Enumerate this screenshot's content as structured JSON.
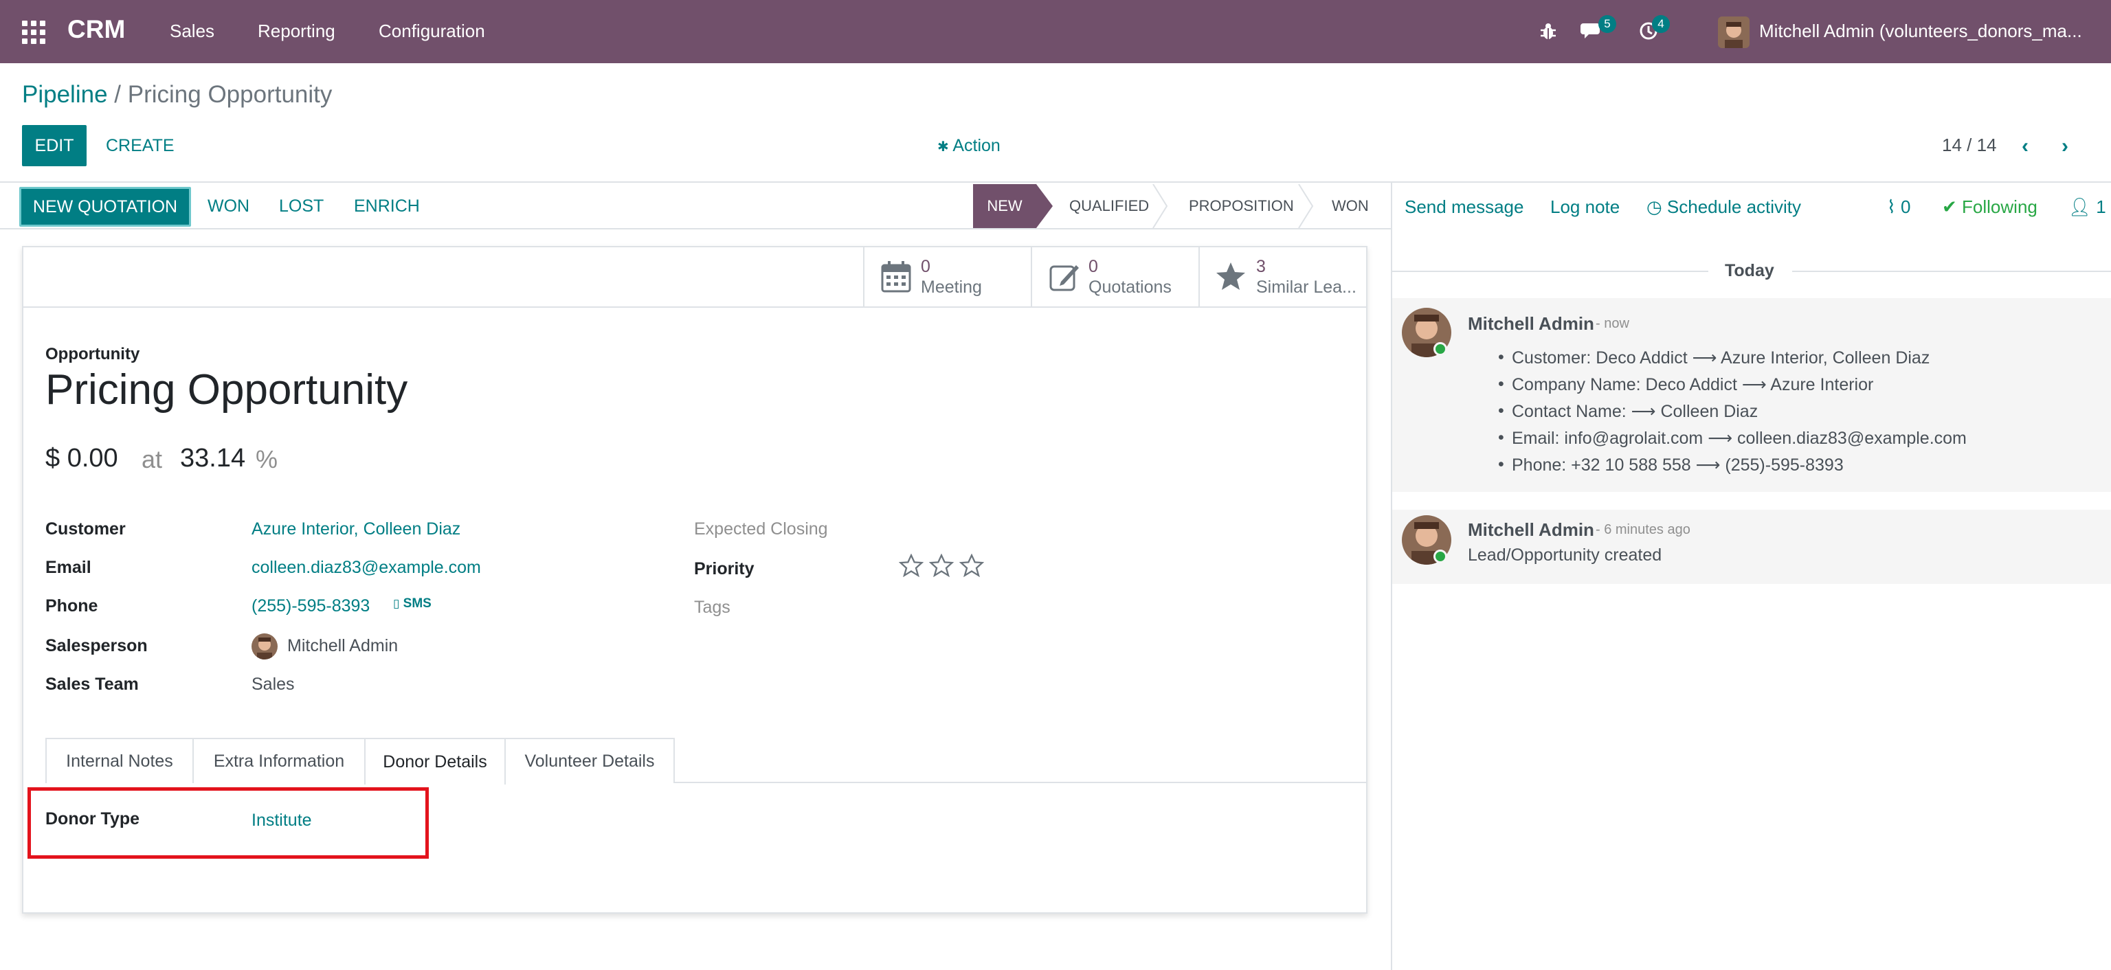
{
  "navbar": {
    "app_name": "CRM",
    "menus": [
      "Sales",
      "Reporting",
      "Configuration"
    ],
    "messages_badge": "5",
    "activities_badge": "4",
    "user": "Mitchell Admin (volunteers_donors_ma..."
  },
  "breadcrumb": {
    "parent": "Pipeline",
    "separator": "/",
    "current": "Pricing Opportunity"
  },
  "control": {
    "edit_label": "EDIT",
    "create_label": "CREATE",
    "action_label": "Action",
    "pager": "14 / 14"
  },
  "statusbar": {
    "new_quotation": "NEW QUOTATION",
    "won": "WON",
    "lost": "LOST",
    "enrich": "ENRICH",
    "stages": [
      "NEW",
      "QUALIFIED",
      "PROPOSITION",
      "WON"
    ],
    "active_stage": "NEW"
  },
  "smart_buttons": [
    {
      "value": "0",
      "label": "Meeting",
      "icon": "calendar-icon"
    },
    {
      "value": "0",
      "label": "Quotations",
      "icon": "pencil-square-icon"
    },
    {
      "value": "3",
      "label": "Similar Lea...",
      "icon": "star-icon"
    }
  ],
  "record": {
    "type_label": "Opportunity",
    "title": "Pricing Opportunity",
    "revenue": "$ 0.00",
    "at_label": "at",
    "probability": "33.14",
    "percent_sign": "%"
  },
  "fields": {
    "customer_label": "Customer",
    "customer": "Azure Interior, Colleen Diaz",
    "email_label": "Email",
    "email": "colleen.diaz83@example.com",
    "phone_label": "Phone",
    "phone": "(255)-595-8393",
    "sms": "SMS",
    "salesperson_label": "Salesperson",
    "salesperson": "Mitchell Admin",
    "sales_team_label": "Sales Team",
    "sales_team": "Sales",
    "expected_closing_label": "Expected Closing",
    "priority_label": "Priority",
    "priority_stars": 0,
    "priority_max": 3,
    "tags_label": "Tags"
  },
  "tabs": [
    "Internal Notes",
    "Extra Information",
    "Donor Details",
    "Volunteer Details"
  ],
  "active_tab": "Donor Details",
  "donor": {
    "type_label": "Donor Type",
    "type_value": "Institute"
  },
  "chatter": {
    "send_message": "Send message",
    "log_note": "Log note",
    "schedule_activity": "Schedule activity",
    "attachments": "0",
    "following": "Following",
    "followers": "1",
    "today": "Today",
    "messages": [
      {
        "author": "Mitchell Admin",
        "when": "- now",
        "changes": [
          "Customer: Deco Addict ⟶ Azure Interior, Colleen Diaz",
          "Company Name: Deco Addict ⟶ Azure Interior",
          "Contact Name: ⟶ Colleen Diaz",
          "Email: info@agrolait.com ⟶ colleen.diaz83@example.com",
          "Phone: +32 10 588 558 ⟶ (255)-595-8393"
        ]
      },
      {
        "author": "Mitchell Admin",
        "when": "- 6 minutes ago",
        "body": "Lead/Opportunity created"
      }
    ]
  }
}
